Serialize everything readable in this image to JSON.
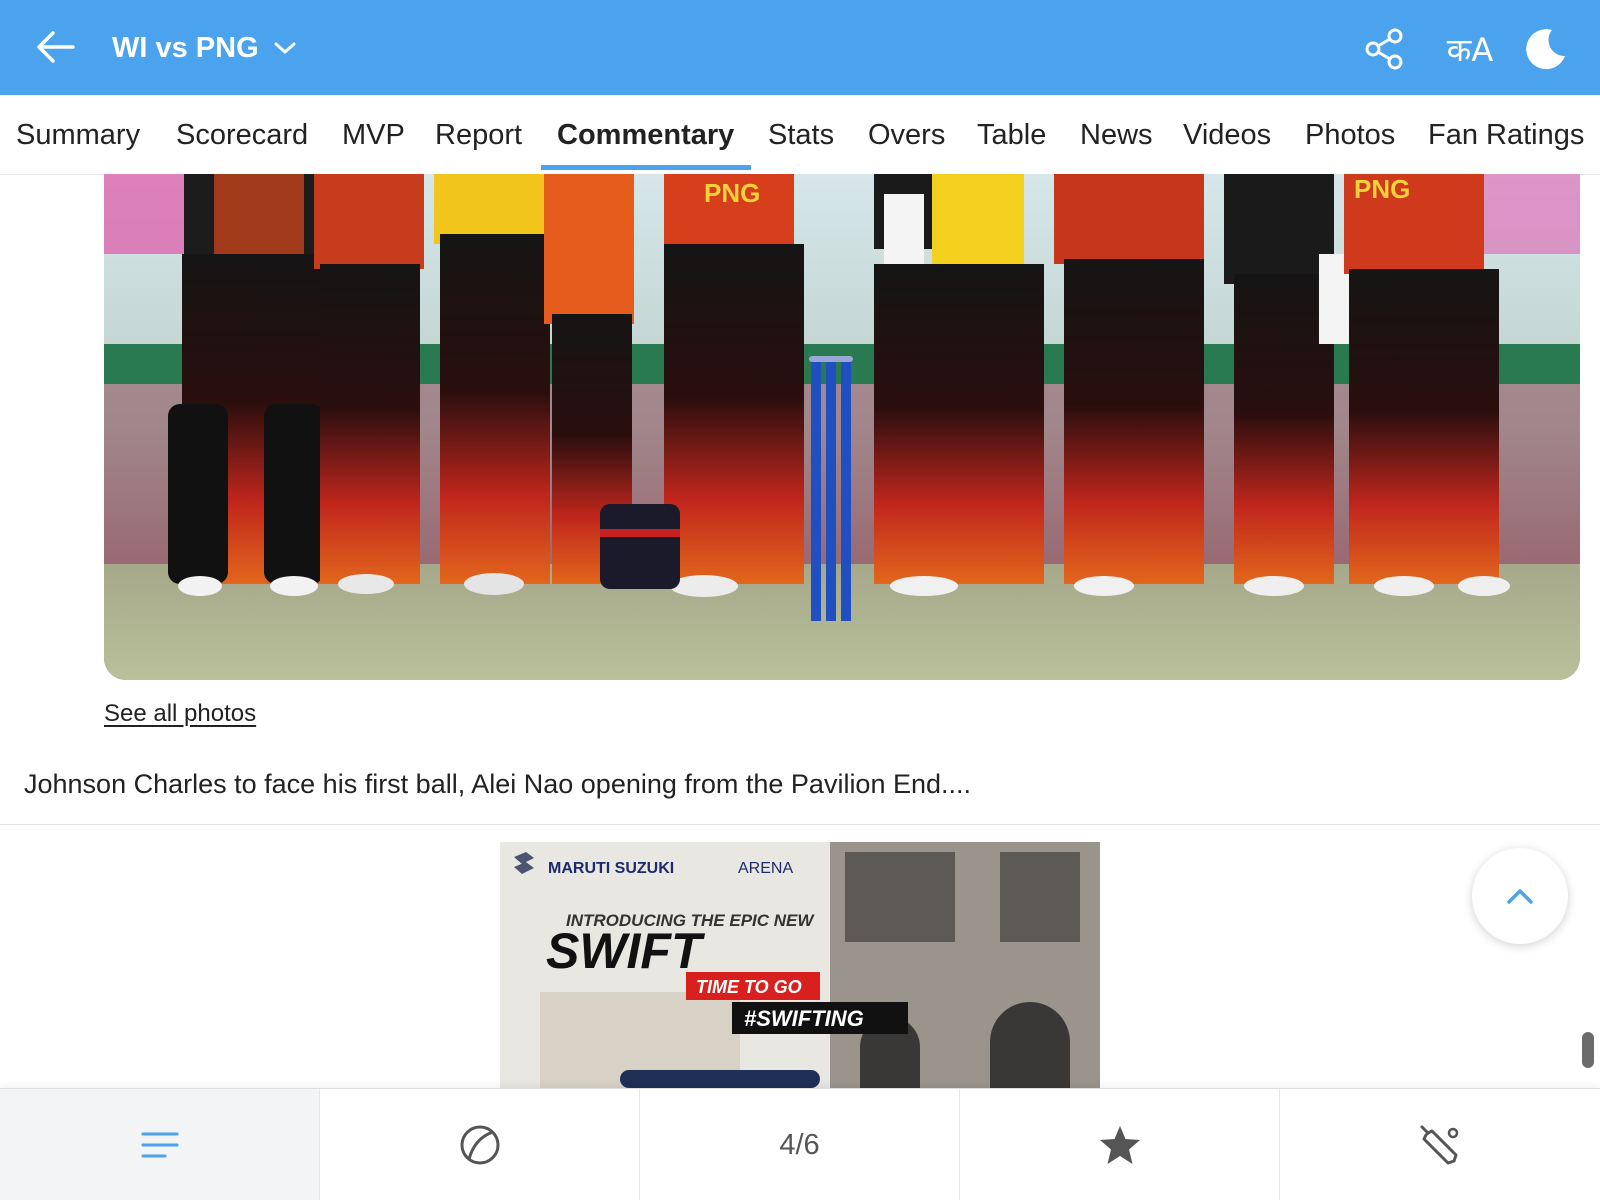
{
  "header": {
    "match_title": "WI vs PNG",
    "icons": [
      "back-arrow-icon",
      "chevron-down-icon",
      "share-icon",
      "language-icon",
      "dark-mode-moon-icon"
    ],
    "language_label": "कA",
    "bar_color": "#4aa3ec"
  },
  "tabs": {
    "items": [
      "Summary",
      "Scorecard",
      "MVP",
      "Report",
      "Commentary",
      "Stats",
      "Overs",
      "Table",
      "News",
      "Videos",
      "Photos",
      "Fan Ratings"
    ],
    "active": "Commentary",
    "accent_color": "#4aa3ec"
  },
  "photo_section": {
    "jersey_text": "PNG",
    "see_all_label": "See all photos"
  },
  "commentary": {
    "text": "Johnson Charles to face his first ball, Alei Nao opening from the Pavilion End...."
  },
  "ad": {
    "brand": "MARUTI SUZUKI",
    "brand_suffix": "ARENA",
    "intro": "INTRODUCING THE EPIC NEW",
    "headline": "SWIFT",
    "tagline": "TIME TO GO",
    "hashtag": "#SWIFTING"
  },
  "bottom_nav": {
    "items": [
      "menu-lines-icon",
      "cricket-ball-icon",
      "pager",
      "star-icon",
      "cricket-bat-icon"
    ],
    "pager_label": "4/6",
    "active_index": 0
  }
}
